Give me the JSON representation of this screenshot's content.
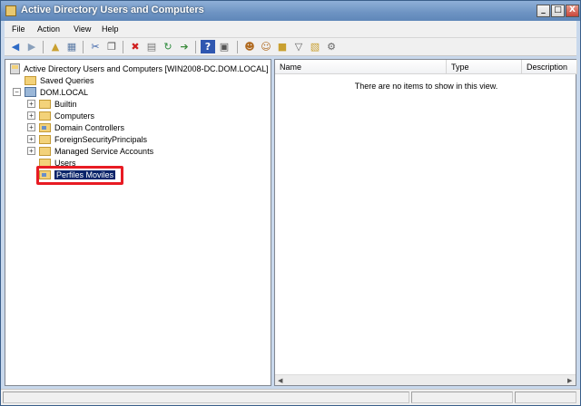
{
  "window": {
    "title": "Active Directory Users and Computers"
  },
  "caption_buttons": {
    "minimize": "_",
    "maximize": "□",
    "close": "X"
  },
  "menu": [
    "File",
    "Action",
    "View",
    "Help"
  ],
  "toolbar": {
    "icons": [
      "back-icon",
      "forward-icon",
      "up-folder-icon",
      "show-console-tree-icon",
      "cut-icon",
      "copy-icon",
      "delete-icon",
      "properties-icon",
      "refresh-icon",
      "export-list-icon",
      "help-icon",
      "action-pane-icon",
      "new-user-icon",
      "new-group-icon",
      "new-ou-icon",
      "filter-icon",
      "add-to-group-icon",
      "delegate-control-icon"
    ]
  },
  "tree": {
    "root": "Active Directory Users and Computers [WIN2008-DC.DOM.LOCAL]",
    "saved_queries": "Saved Queries",
    "domain": "DOM.LOCAL",
    "children": [
      "Builtin",
      "Computers",
      "Domain Controllers",
      "ForeignSecurityPrincipals",
      "Managed Service Accounts",
      "Users"
    ],
    "selected_ou": "Perfiles Moviles"
  },
  "list": {
    "columns": [
      "Name",
      "Type",
      "Description"
    ],
    "empty_message": "There are no items to show in this view."
  },
  "colors": {
    "selection": "#0a246a",
    "highlight_box": "#e81b23"
  }
}
